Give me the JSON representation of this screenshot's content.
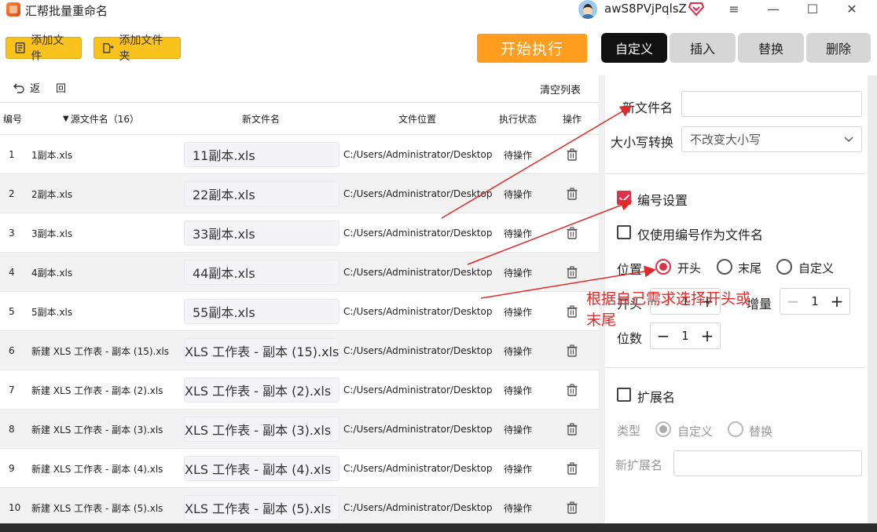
{
  "app": {
    "title": "汇帮批量重命名",
    "username": "awS8PVjPqlsZ"
  },
  "window_controls": [
    "≡",
    "—",
    "☐",
    "✕"
  ],
  "toolbar": {
    "add_files": "添加文件",
    "add_folder": "添加文件夹",
    "start": "开始执行"
  },
  "tabs": [
    {
      "label": "自定义",
      "active": true
    },
    {
      "label": "插入",
      "active": false
    },
    {
      "label": "替换",
      "active": false
    },
    {
      "label": "删除",
      "active": false
    }
  ],
  "list": {
    "back_label": "返",
    "back_label2": "回",
    "clear_label": "清空列表",
    "headers": {
      "index": "编号",
      "source": "源文件名（16）",
      "new_name": "新文件名",
      "location": "文件位置",
      "status": "执行状态",
      "action": "操作"
    },
    "rows": [
      {
        "index": "1",
        "source": "1副本.xls",
        "new_name": "11副本.xls",
        "location": "C:/Users/Administrator/Desktop/",
        "status": "待操作"
      },
      {
        "index": "2",
        "source": "2副本.xls",
        "new_name": "22副本.xls",
        "location": "C:/Users/Administrator/Desktop/",
        "status": "待操作"
      },
      {
        "index": "3",
        "source": "3副本.xls",
        "new_name": "33副本.xls",
        "location": "C:/Users/Administrator/Desktop/",
        "status": "待操作"
      },
      {
        "index": "4",
        "source": "4副本.xls",
        "new_name": "44副本.xls",
        "location": "C:/Users/Administrator/Desktop/",
        "status": "待操作"
      },
      {
        "index": "5",
        "source": "5副本.xls",
        "new_name": "55副本.xls",
        "location": "C:/Users/Administrator/Desktop/",
        "status": "待操作"
      },
      {
        "index": "6",
        "source": "新建 XLS 工作表 - 副本 (15).xls",
        "new_name": "XLS 工作表 - 副本 (15).xls",
        "location": "C:/Users/Administrator/Desktop/",
        "status": "待操作"
      },
      {
        "index": "7",
        "source": "新建 XLS 工作表 - 副本 (2).xls",
        "new_name": "XLS 工作表 - 副本 (2).xls",
        "location": "C:/Users/Administrator/Desktop/",
        "status": "待操作"
      },
      {
        "index": "8",
        "source": "新建 XLS 工作表 - 副本 (3).xls",
        "new_name": "XLS 工作表 - 副本 (3).xls",
        "location": "C:/Users/Administrator/Desktop/",
        "status": "待操作"
      },
      {
        "index": "9",
        "source": "新建 XLS 工作表 - 副本 (4).xls",
        "new_name": "XLS 工作表 - 副本 (4).xls",
        "location": "C:/Users/Administrator/Desktop/",
        "status": "待操作"
      },
      {
        "index": "10",
        "source": "新建 XLS 工作表 - 副本 (5).xls",
        "new_name": "XLS 工作表 - 副本 (5).xls",
        "location": "C:/Users/Administrator/Desktop/",
        "status": "待操作"
      }
    ]
  },
  "panel": {
    "new_name_label": "新文件名",
    "new_name_value": "",
    "case_label": "大小写转换",
    "case_value": "不改变大小写",
    "numbering": {
      "label": "编号设置",
      "checked": true,
      "only_number_label": "仅使用编号作为文件名",
      "position_label": "位置",
      "positions": [
        {
          "label": "开头",
          "selected": true
        },
        {
          "label": "末尾",
          "selected": false
        },
        {
          "label": "自定义",
          "selected": false
        }
      ],
      "start_label": "开头",
      "start_value": "1",
      "increment_label": "增量",
      "increment_value": "1",
      "digits_label": "位数",
      "digits_value": "1"
    },
    "extension": {
      "label": "扩展名",
      "type_label": "类型",
      "types": [
        {
          "label": "自定义",
          "selected": true
        },
        {
          "label": "替换",
          "selected": false
        }
      ],
      "new_ext_label": "新扩展名",
      "new_ext_value": ""
    }
  },
  "annotation": "根据自己需求选择开头或末尾",
  "colors": {
    "accent": "#e0314b",
    "toolbar_yellow": "#f9c21d",
    "start_orange": "#ff9d1e",
    "arrow_red": "#e02a2a"
  }
}
